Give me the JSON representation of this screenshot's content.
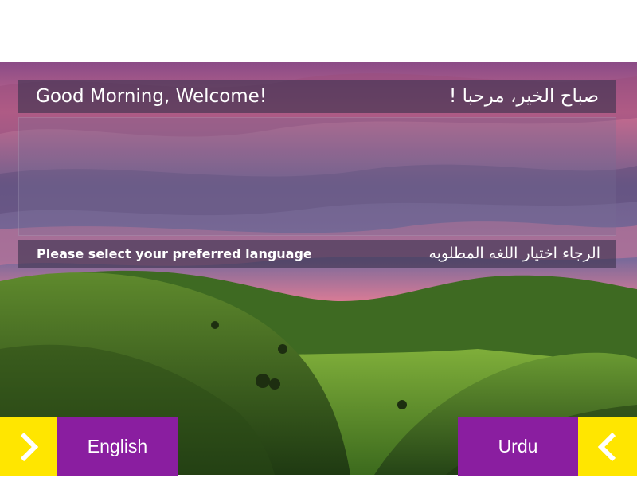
{
  "welcome": {
    "english": "Good Morning, Welcome!",
    "arabic": "صباح الخير، مرحبا !"
  },
  "prompt": {
    "english": "Please select your preferred language",
    "arabic": "الرجاء اختيار اللغه المطلوبه"
  },
  "buttons": {
    "english": {
      "label": "English",
      "icon": "chevron-right-icon"
    },
    "urdu": {
      "label": "Urdu",
      "icon": "chevron-left-icon"
    }
  },
  "colors": {
    "button_purple": "#8a1ea0",
    "arrow_yellow": "#ffe600",
    "banner_overlay": "#3a324e"
  }
}
